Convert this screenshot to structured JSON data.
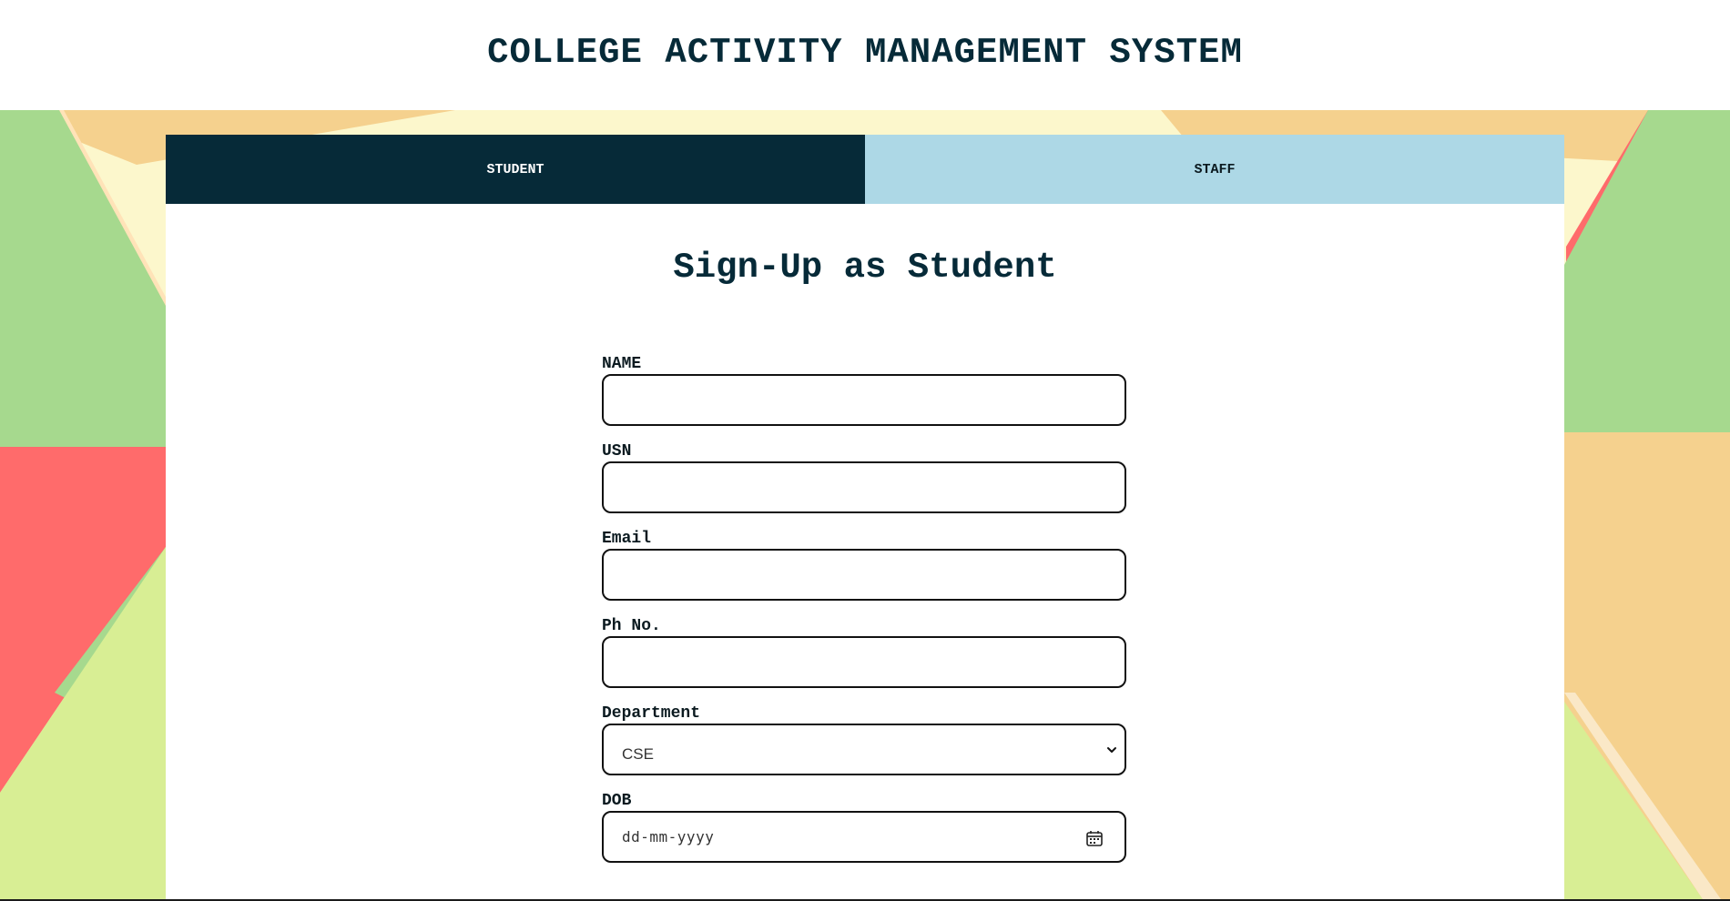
{
  "header": {
    "title": "COLLEGE ACTIVITY MANAGEMENT SYSTEM"
  },
  "tabs": [
    {
      "label": "STUDENT",
      "active": true
    },
    {
      "label": "STAFF",
      "active": false
    }
  ],
  "form": {
    "title": "Sign-Up as Student",
    "fields": {
      "name": {
        "label": "NAME",
        "value": ""
      },
      "usn": {
        "label": "USN",
        "value": ""
      },
      "email": {
        "label": "Email",
        "value": ""
      },
      "phone": {
        "label": "Ph No.",
        "value": ""
      },
      "department": {
        "label": "Department",
        "selected": "CSE"
      },
      "dob": {
        "label": "DOB",
        "placeholder": "dd-mm-yyyy"
      }
    }
  },
  "colors": {
    "accent_dark": "#062a38",
    "tab_inactive": "#add8e6",
    "bg_green": "#a6d98e",
    "bg_orange": "#f5d18e",
    "bg_red": "#ff6b6b",
    "bg_yellow": "#fcf7cc",
    "bg_lime": "#d8ee94",
    "bg_peach": "#ffe3b8"
  },
  "icons": {
    "select_arrow": "chevron-down-icon",
    "date_picker": "calendar-icon"
  }
}
